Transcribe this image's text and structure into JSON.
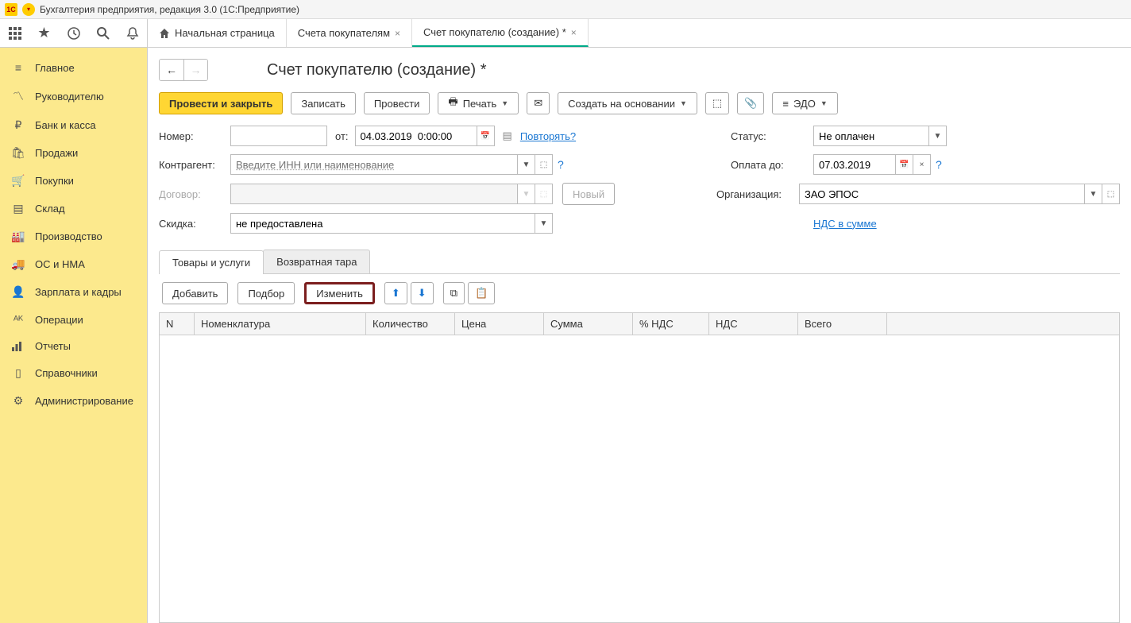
{
  "titlebar": {
    "app_title": "Бухгалтерия предприятия, редакция 3.0   (1С:Предприятие)"
  },
  "tabs": {
    "home": "Начальная страница",
    "tab1": "Счета покупателям",
    "tab2": "Счет покупателю (создание) *"
  },
  "sidebar": {
    "main": "Главное",
    "manager": "Руководителю",
    "bank": "Банк и касса",
    "sales": "Продажи",
    "purchases": "Покупки",
    "warehouse": "Склад",
    "production": "Производство",
    "assets": "ОС и НМА",
    "salary": "Зарплата и кадры",
    "operations": "Операции",
    "reports": "Отчеты",
    "refs": "Справочники",
    "admin": "Администрирование"
  },
  "page": {
    "title": "Счет покупателю (создание) *"
  },
  "actions": {
    "post_close": "Провести и закрыть",
    "save": "Записать",
    "post": "Провести",
    "print": "Печать",
    "create_based": "Создать на основании",
    "edo": "ЭДО"
  },
  "form": {
    "number_label": "Номер:",
    "number_value": "",
    "from_label": "от:",
    "date_value": "04.03.2019  0:00:00",
    "repeat_link": "Повторять?",
    "counterparty_label": "Контрагент:",
    "counterparty_placeholder": "Введите ИНН или наименование",
    "contract_label": "Договор:",
    "new_btn": "Новый",
    "discount_label": "Скидка:",
    "discount_value": "не предоставлена",
    "status_label": "Статус:",
    "status_value": "Не оплачен",
    "pay_before_label": "Оплата до:",
    "pay_before_value": "07.03.2019",
    "org_label": "Организация:",
    "org_value": "ЗАО ЭПОС",
    "vat_link": "НДС в сумме"
  },
  "doc_tabs": {
    "goods": "Товары и услуги",
    "tare": "Возвратная тара"
  },
  "table_toolbar": {
    "add": "Добавить",
    "select": "Подбор",
    "change": "Изменить"
  },
  "table": {
    "col_n": "N",
    "col_nom": "Номенклатура",
    "col_qty": "Количество",
    "col_price": "Цена",
    "col_sum": "Сумма",
    "col_vatpct": "% НДС",
    "col_vat": "НДС",
    "col_total": "Всего"
  }
}
